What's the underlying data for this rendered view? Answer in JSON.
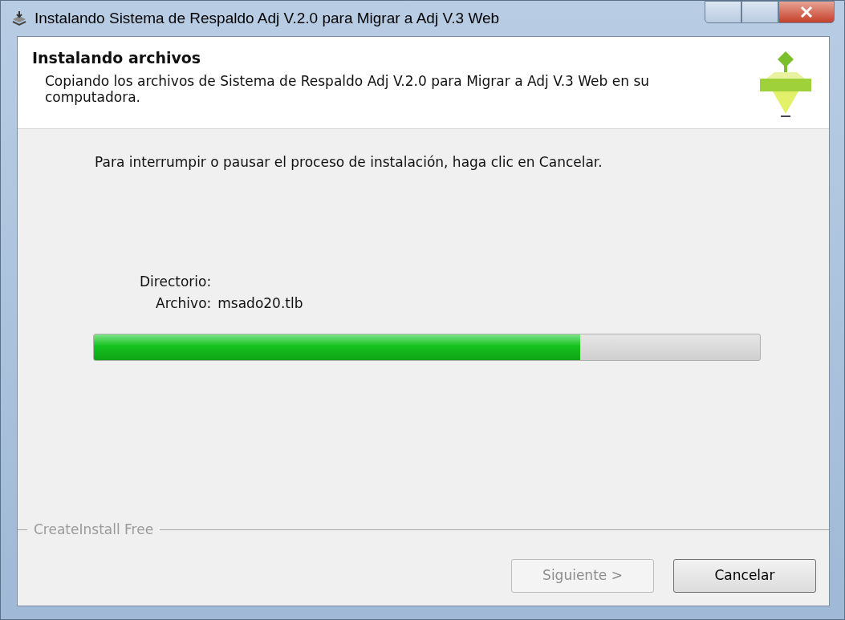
{
  "window": {
    "title": "Instalando Sistema de Respaldo Adj V.2.0 para Migrar a Adj V.3 Web"
  },
  "header": {
    "title": "Instalando archivos",
    "subtitle": "Copiando los archivos de Sistema de Respaldo Adj V.2.0 para Migrar a Adj V.3 Web en su computadora."
  },
  "instructions": "Para interrumpir o pausar el proceso de instalación, haga clic en Cancelar.",
  "directory": {
    "label": "Directorio:"
  },
  "file": {
    "label": "Archivo:",
    "value": "msado20.tlb"
  },
  "progress": {
    "level": 0.73
  },
  "footer": {
    "brand": "CreateInstall Free"
  },
  "buttons": [
    {
      "label": "Siguiente >",
      "disabled": true
    },
    {
      "label": "Cancelar",
      "disabled": false
    }
  ]
}
